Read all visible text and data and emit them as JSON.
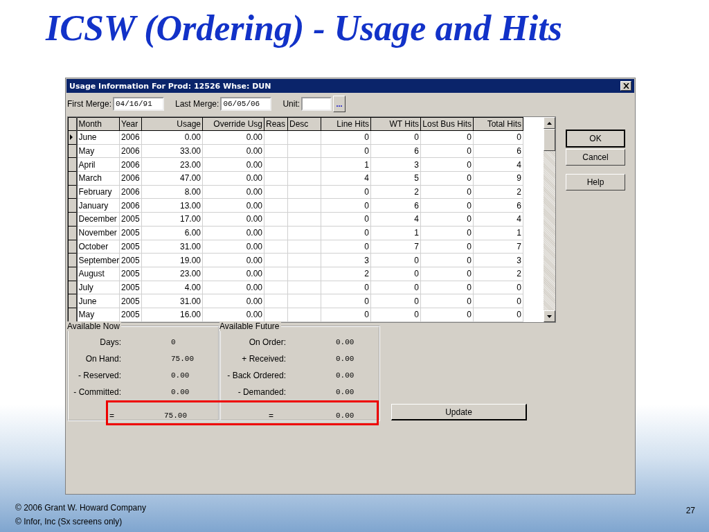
{
  "slide": {
    "title": "ICSW (Ordering) - Usage and Hits",
    "footer": [
      "©  2006 Grant W. Howard Company",
      "©  Infor, Inc (Sx screens only)"
    ],
    "page_number": "27"
  },
  "window": {
    "title": "Usage Information For Prod: 12526 Whse: DUN"
  },
  "merge": {
    "first_label": "First Merge:",
    "first_value": "04/16/91",
    "last_label": "Last Merge:",
    "last_value": "06/05/06",
    "unit_label": "Unit:",
    "lookup_button": "..."
  },
  "table": {
    "columns": [
      {
        "label": "Month",
        "kind": "text"
      },
      {
        "label": "Year",
        "kind": "text"
      },
      {
        "label": "Usage",
        "kind": "number"
      },
      {
        "label": "Override Usg",
        "kind": "number"
      },
      {
        "label": "Reas",
        "kind": "text"
      },
      {
        "label": "Desc",
        "kind": "text"
      },
      {
        "label": "Line Hits",
        "kind": "number"
      },
      {
        "label": "WT Hits",
        "kind": "number"
      },
      {
        "label": "Lost Bus Hits",
        "kind": "number"
      },
      {
        "label": "Total Hits",
        "kind": "number"
      }
    ],
    "rows": [
      {
        "selected": true,
        "cells": [
          "June",
          "2006",
          "0.00",
          "0.00",
          "",
          "",
          "0",
          "0",
          "0",
          "0"
        ]
      },
      {
        "selected": false,
        "cells": [
          "May",
          "2006",
          "33.00",
          "0.00",
          "",
          "",
          "0",
          "6",
          "0",
          "6"
        ]
      },
      {
        "selected": false,
        "cells": [
          "April",
          "2006",
          "23.00",
          "0.00",
          "",
          "",
          "1",
          "3",
          "0",
          "4"
        ]
      },
      {
        "selected": false,
        "cells": [
          "March",
          "2006",
          "47.00",
          "0.00",
          "",
          "",
          "4",
          "5",
          "0",
          "9"
        ]
      },
      {
        "selected": false,
        "cells": [
          "February",
          "2006",
          "8.00",
          "0.00",
          "",
          "",
          "0",
          "2",
          "0",
          "2"
        ]
      },
      {
        "selected": false,
        "cells": [
          "January",
          "2006",
          "13.00",
          "0.00",
          "",
          "",
          "0",
          "6",
          "0",
          "6"
        ]
      },
      {
        "selected": false,
        "cells": [
          "December",
          "2005",
          "17.00",
          "0.00",
          "",
          "",
          "0",
          "4",
          "0",
          "4"
        ]
      },
      {
        "selected": false,
        "cells": [
          "November",
          "2005",
          "6.00",
          "0.00",
          "",
          "",
          "0",
          "1",
          "0",
          "1"
        ]
      },
      {
        "selected": false,
        "cells": [
          "October",
          "2005",
          "31.00",
          "0.00",
          "",
          "",
          "0",
          "7",
          "0",
          "7"
        ]
      },
      {
        "selected": false,
        "cells": [
          "September",
          "2005",
          "19.00",
          "0.00",
          "",
          "",
          "3",
          "0",
          "0",
          "3"
        ]
      },
      {
        "selected": false,
        "cells": [
          "August",
          "2005",
          "23.00",
          "0.00",
          "",
          "",
          "2",
          "0",
          "0",
          "2"
        ]
      },
      {
        "selected": false,
        "cells": [
          "July",
          "2005",
          "4.00",
          "0.00",
          "",
          "",
          "0",
          "0",
          "0",
          "0"
        ]
      },
      {
        "selected": false,
        "cells": [
          "June",
          "2005",
          "31.00",
          "0.00",
          "",
          "",
          "0",
          "0",
          "0",
          "0"
        ]
      },
      {
        "selected": false,
        "cells": [
          "May",
          "2005",
          "16.00",
          "0.00",
          "",
          "",
          "0",
          "0",
          "0",
          "0"
        ]
      }
    ]
  },
  "buttons": [
    {
      "label": "OK",
      "default": true
    },
    {
      "label": "Cancel",
      "default": false
    },
    {
      "label": "Help",
      "default": false
    }
  ],
  "available_now": {
    "title": "Available Now",
    "rows": [
      {
        "label": "Days:",
        "value": "0"
      },
      {
        "label": "On Hand:",
        "value": "75.00"
      },
      {
        "label": "- Reserved:",
        "value": "0.00"
      },
      {
        "label": "- Committed:",
        "value": "0.00"
      }
    ],
    "total": {
      "label": "=",
      "value": "75.00"
    }
  },
  "available_future": {
    "title": "Available Future",
    "rows": [
      {
        "label": "On Order:",
        "value": "0.00"
      },
      {
        "label": "+ Received:",
        "value": "0.00"
      },
      {
        "label": "- Back Ordered:",
        "value": "0.00"
      },
      {
        "label": "- Demanded:",
        "value": "0.00"
      }
    ],
    "total": {
      "label": "=",
      "value": "0.00"
    }
  },
  "update_button": "Update"
}
